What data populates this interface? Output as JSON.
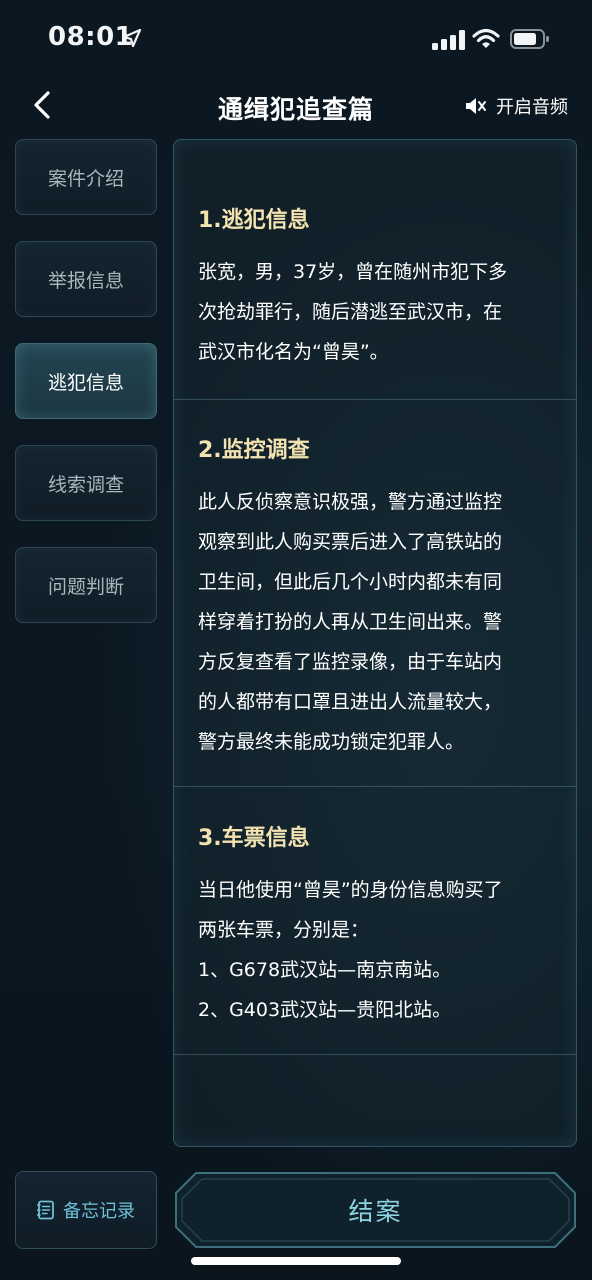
{
  "status_bar": {
    "time": "08:01"
  },
  "header": {
    "title": "通缉犯追查篇",
    "audio_label": "开启音频"
  },
  "sidebar": {
    "items": [
      {
        "label": "案件介绍",
        "active": false
      },
      {
        "label": "举报信息",
        "active": false
      },
      {
        "label": "逃犯信息",
        "active": true
      },
      {
        "label": "线索调查",
        "active": false
      },
      {
        "label": "问题判断",
        "active": false
      }
    ]
  },
  "content": {
    "sections": [
      {
        "title": "1.逃犯信息",
        "lines": [
          "张宽，男，37岁，曾在随州市犯下多",
          "次抢劫罪行，随后潜逃至武汉市，在",
          "武汉市化名为“曾昊”。"
        ]
      },
      {
        "title": "2.监控调查",
        "lines": [
          "此人反侦察意识极强，警方通过监控",
          "观察到此人购买票后进入了高铁站的",
          "卫生间，但此后几个小时内都未有同",
          "样穿着打扮的人再从卫生间出来。警",
          "方反复查看了监控录像，由于车站内",
          "的人都带有口罩且进出人流量较大，",
          "警方最终未能成功锁定犯罪人。"
        ]
      },
      {
        "title": "3.车票信息",
        "lines": [
          "当日他使用“曾昊”的身份信息购买了",
          "两张车票，分别是：",
          "1、G678武汉站—南京南站。",
          "2、G403武汉站—贵阳北站。"
        ]
      }
    ]
  },
  "bottom": {
    "memo_label": "备忘记录",
    "close_case_label": "结案"
  },
  "colors": {
    "background": "#0b1620",
    "section_title": "#f3e3b0",
    "accent": "#8fd4e3"
  }
}
